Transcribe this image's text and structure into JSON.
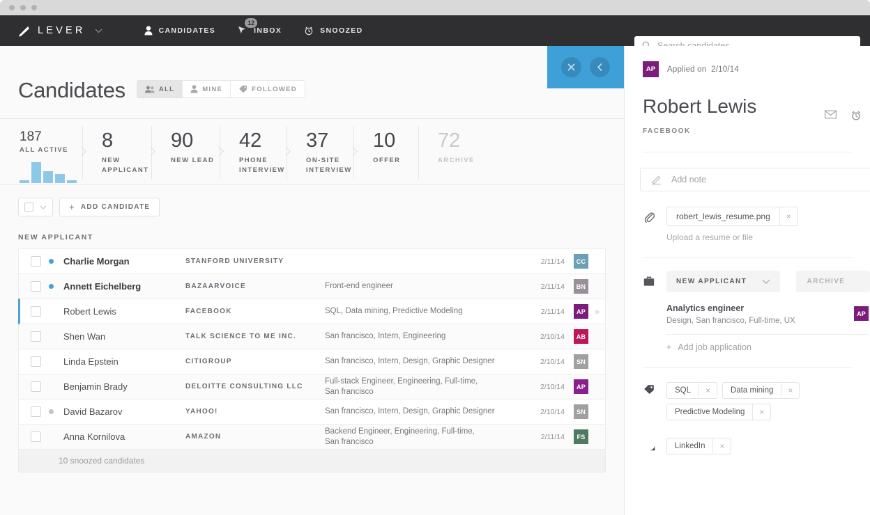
{
  "window": {
    "dots": 3
  },
  "topnav": {
    "brand": "LEVER",
    "brand_caret": "chevron-down",
    "items": [
      {
        "label": "CANDIDATES",
        "icon": "person-icon",
        "badge": null
      },
      {
        "label": "INBOX",
        "icon": "inbox-icon",
        "badge": "12"
      },
      {
        "label": "SNOOZED",
        "icon": "alarm-clock-icon",
        "badge": null
      }
    ],
    "search": {
      "placeholder": "Search candidates",
      "value": "",
      "icon": "search-icon"
    }
  },
  "page": {
    "title": "Candidates",
    "segments": [
      {
        "label": "ALL",
        "icon": "people-icon",
        "active": true
      },
      {
        "label": "MINE",
        "icon": "person-icon",
        "active": false
      },
      {
        "label": "FOLLOWED",
        "icon": "tag-icon",
        "active": false
      }
    ]
  },
  "pipeline": {
    "stages": [
      {
        "count": "187",
        "label": "ALL ACTIVE",
        "muted": false,
        "first": true
      },
      {
        "count": "8",
        "label": "NEW APPLICANT",
        "muted": false,
        "first": false
      },
      {
        "count": "90",
        "label": "NEW LEAD",
        "muted": false,
        "first": false
      },
      {
        "count": "42",
        "label": "PHONE INTERVIEW",
        "muted": false,
        "first": false
      },
      {
        "count": "37",
        "label": "ON-SITE INTERVIEW",
        "muted": false,
        "first": false
      },
      {
        "count": "10",
        "label": "OFFER",
        "muted": false,
        "first": false
      },
      {
        "count": "72",
        "label": "ARCHIVE",
        "muted": true,
        "first": false
      }
    ],
    "spark_values": [
      4,
      30,
      17,
      13,
      4
    ],
    "spark_color": "#8ec8e8"
  },
  "toolbar": {
    "select_all_label": "",
    "add_candidate_label": "ADD CANDIDATE",
    "add_icon": "plus-icon"
  },
  "list": {
    "group_label": "NEW APPLICANT",
    "rows": [
      {
        "name": "Charlie Morgan",
        "org": "STANFORD UNIVERSITY",
        "tags": "",
        "date": "2/11/14",
        "initials": "CC",
        "color": "#6c9fb5",
        "dot": "blue",
        "unread": true,
        "selected": false
      },
      {
        "name": "Annett Eichelberg",
        "org": "BAZAARVOICE",
        "tags": "Front-end engineer",
        "date": "2/11/14",
        "initials": "BN",
        "color": "#9a8e9a",
        "dot": "blue",
        "unread": true,
        "selected": false
      },
      {
        "name": "Robert Lewis",
        "org": "FACEBOOK",
        "tags": "SQL, Data mining, Predictive Modeling",
        "date": "2/11/14",
        "initials": "AP",
        "color": "#7c1d7c",
        "dot": "none",
        "unread": false,
        "selected": true
      },
      {
        "name": "Shen Wan",
        "org": "TALK SCIENCE TO ME INC.",
        "tags": "San francisco, Intern, Engineering",
        "date": "2/10/14",
        "initials": "AB",
        "color": "#bd1759",
        "dot": "none",
        "unread": false,
        "selected": false
      },
      {
        "name": "Linda Epstein",
        "org": "CITIGROUP",
        "tags": "San francisco, Intern, Design, Graphic Designer",
        "date": "2/10/14",
        "initials": "SN",
        "color": "#a0a0a0",
        "dot": "none",
        "unread": false,
        "selected": false
      },
      {
        "name": "Benjamin Brady",
        "org": "DELOITTE CONSULTING LLC",
        "tags": "Full-stack Engineer, Engineering, Full-time, San francisco",
        "date": "2/10/14",
        "initials": "AP",
        "color": "#8b1f8b",
        "dot": "none",
        "unread": false,
        "selected": false
      },
      {
        "name": "David Bazarov",
        "org": "YAHOO!",
        "tags": "San francisco, Intern, Design, Graphic Designer",
        "date": "2/10/14",
        "initials": "SN",
        "color": "#a0a0a0",
        "dot": "grey",
        "unread": false,
        "selected": false
      },
      {
        "name": "Anna Kornilova",
        "org": "AMAZON",
        "tags": "Backend Engineer, Engineering, Full-time, San francisco",
        "date": "2/11/14",
        "initials": "FS",
        "color": "#4f7a62",
        "dot": "none",
        "unread": false,
        "selected": false
      }
    ],
    "snoozed_label": "10 snoozed candidates"
  },
  "bluebar": {
    "close_icon": "close-icon",
    "back_icon": "chevron-left-icon",
    "color": "#3fa0d8"
  },
  "detail": {
    "avatar_initials": "AP",
    "avatar_color": "#7c1d7c",
    "applied_label": "Applied on",
    "applied_date": "2/10/14",
    "header_icons": [
      {
        "name": "envelope-icon"
      },
      {
        "name": "alarm-clock-icon"
      }
    ],
    "name": "Robert Lewis",
    "org": "FACEBOOK",
    "note": {
      "placeholder": "Add note",
      "icon": "pencil-icon"
    },
    "attachment": {
      "icon": "paperclip-icon",
      "filename": "robert_lewis_resume.png",
      "remove_label": "×",
      "hint": "Upload a resume or file"
    },
    "job": {
      "icon": "briefcase-icon",
      "stage": "NEW APPLICANT",
      "stage_caret": "chevron-down-icon",
      "archive_label": "ARCHIVE",
      "title": "Analytics engineer",
      "subtitle": "Design, San francisco, Full-time, UX",
      "avatar_initials": "AP",
      "add_label": "Add job application",
      "add_icon": "plus-icon"
    },
    "tags": {
      "icon": "tag-icon",
      "items": [
        "SQL",
        "Data mining",
        "Predictive Modeling"
      ],
      "remove_label": "×"
    },
    "sources": {
      "icon": "source-icon",
      "items": [
        "LinkedIn"
      ],
      "remove_label": "×"
    }
  }
}
